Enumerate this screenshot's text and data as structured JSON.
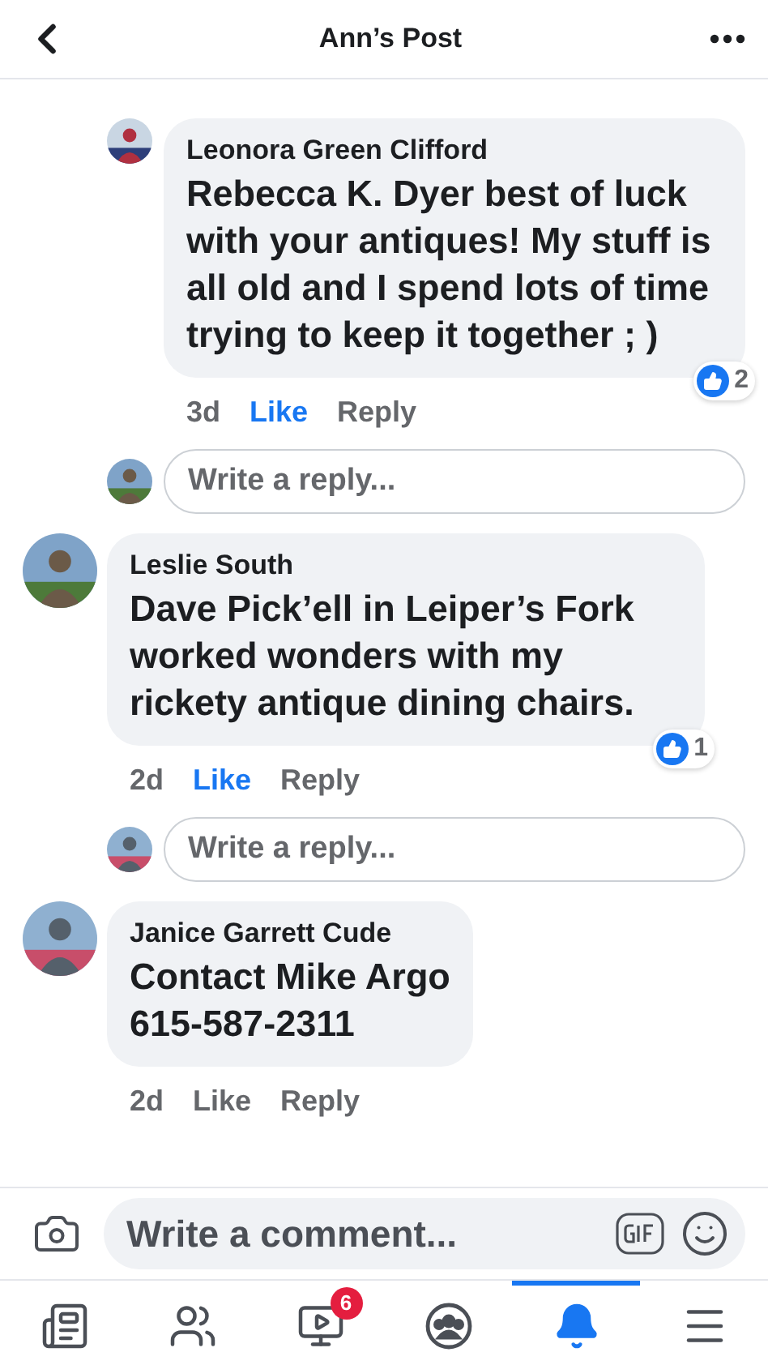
{
  "header": {
    "title": "Ann’s Post"
  },
  "thread": [
    {
      "kind": "reply",
      "author": "Leonora Green Clifford",
      "text": "**Rebecca K. Dyer** best of luck with your antiques!  My stuff is all old and I spend lots of time trying to keep it together ; )",
      "time": "3d",
      "like": "Like",
      "liked": true,
      "reply": "Reply",
      "reactions": "2"
    },
    {
      "kind": "reply_field",
      "placeholder": "Write a reply..."
    },
    {
      "kind": "comment",
      "author": "Leslie South",
      "text": "Dave Pick’ell in Leiper’s Fork worked wonders with my rickety antique dining chairs.",
      "time": "2d",
      "like": "Like",
      "liked": true,
      "reply": "Reply",
      "reactions": "1"
    },
    {
      "kind": "reply_field",
      "placeholder": "Write a reply..."
    },
    {
      "kind": "comment",
      "author": "Janice Garrett Cude",
      "text": "Contact Mike Argo\n615-587-2311",
      "time": "2d",
      "like": "Like",
      "liked": false,
      "reply": "Reply"
    }
  ],
  "composer": {
    "placeholder": "Write a comment..."
  },
  "tabs": [
    {
      "kind": "news",
      "selected": false
    },
    {
      "kind": "friends",
      "selected": false
    },
    {
      "kind": "video",
      "selected": false,
      "badge": "6"
    },
    {
      "kind": "groups",
      "selected": false
    },
    {
      "kind": "notifications",
      "selected": true
    },
    {
      "kind": "menu",
      "selected": false
    }
  ]
}
